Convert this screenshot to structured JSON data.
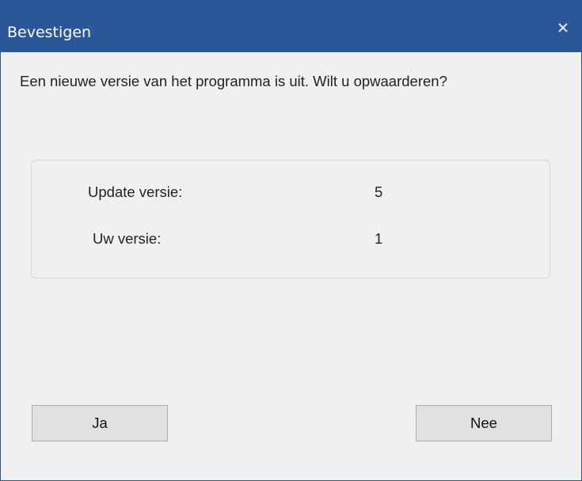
{
  "window": {
    "title": "Bevestigen",
    "close_icon": "close-icon"
  },
  "message": "Een nieuwe versie van het programma is uit. Wilt u opwaarderen?",
  "versions": {
    "update_label": "Update versie:",
    "update_value": "5",
    "current_label": "Uw versie:",
    "current_value": "1"
  },
  "buttons": {
    "yes_label": "Ja",
    "no_label": "Nee"
  },
  "colors": {
    "titlebar": "#2b579a",
    "dialog_background": "#f0f0f0",
    "button_background": "#e1e1e1"
  }
}
